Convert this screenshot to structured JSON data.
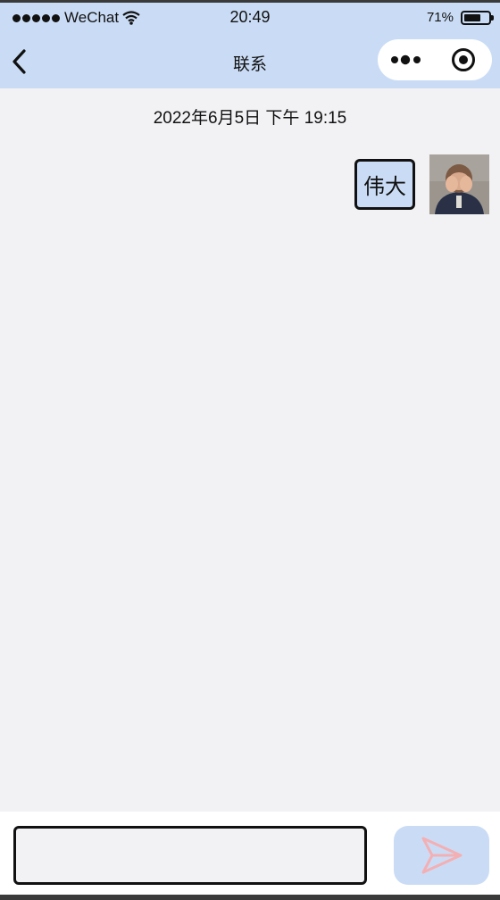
{
  "status_bar": {
    "carrier": "WeChat",
    "time": "20:49",
    "battery": "71%",
    "battery_level": 0.71
  },
  "nav": {
    "title": "联系",
    "back_icon": "chevron-left-icon",
    "more_icon": "more-dots-icon",
    "close_icon": "target-circle-icon"
  },
  "chat": {
    "timestamp": "2022年6月5日 下午 19:15",
    "messages": [
      {
        "text": "伟大",
        "sender": "self"
      }
    ]
  },
  "input": {
    "value": "",
    "placeholder": "",
    "send_icon": "send-icon"
  },
  "colors": {
    "header_bg": "#cadcf5",
    "chat_bg": "#f2f2f5",
    "send_icon": "#f3b0b4"
  }
}
